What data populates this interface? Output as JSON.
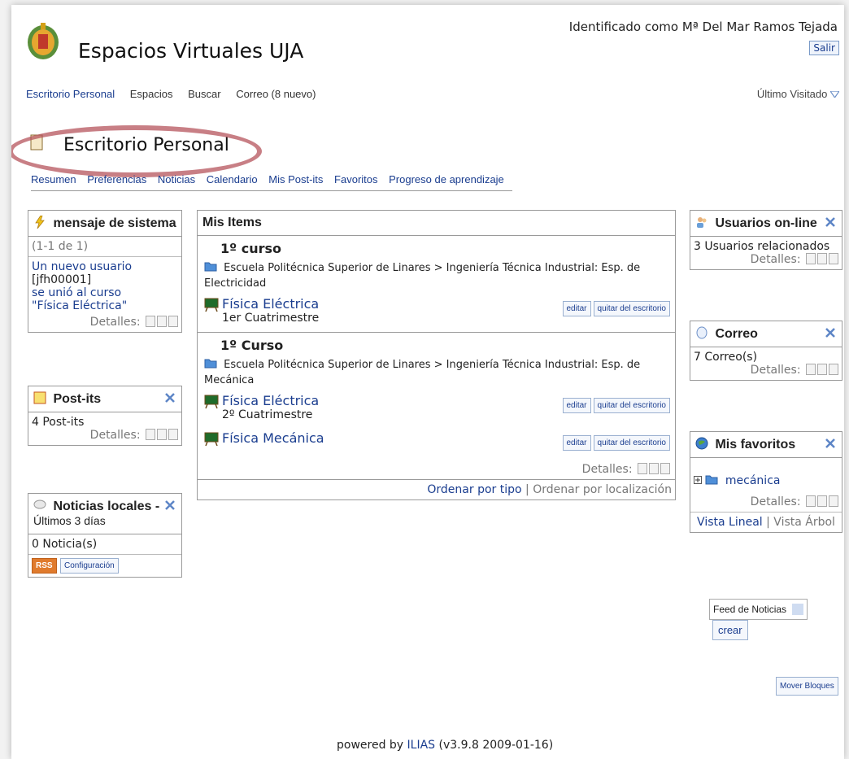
{
  "header": {
    "site_title": "Espacios Virtuales UJA",
    "user_label": "Identificado como Mª Del Mar Ramos Tejada",
    "logout": "Salir"
  },
  "topnav": {
    "items": [
      "Escritorio Personal",
      "Espacios",
      "Buscar",
      "Correo (8 nuevo)"
    ],
    "last_visited": "Último Visitado"
  },
  "page": {
    "title": "Escritorio Personal",
    "tabs": [
      "Resumen",
      "Preferencias",
      "Noticias",
      "Calendario",
      "Mis Post-its",
      "Favoritos",
      "Progreso de aprendizaje"
    ]
  },
  "common": {
    "details": "Detalles:"
  },
  "system_message": {
    "title": "mensaje de sistema",
    "range": "(1-1 de 1)",
    "message_link": "Un nuevo usuario",
    "message_user": "[jfh00001]",
    "message_link2": "se unió al curso",
    "message_link3": "\"Física Eléctrica\""
  },
  "postits": {
    "title": "Post-its",
    "count": "4 Post-its"
  },
  "news": {
    "title": "Noticias locales -",
    "subtitle": "Últimos 3 días",
    "count": "0 Noticia(s)",
    "rss": "RSS",
    "config": "Configuración"
  },
  "items": {
    "title": "Mis Items",
    "edit": "editar",
    "remove": "quitar del escritorio",
    "groups": [
      {
        "title": "1º curso",
        "path": "Escuela Politécnica Superior de Linares > Ingeniería Técnica Industrial: Esp. de Electricidad",
        "courses": [
          {
            "name": "Física Eléctrica",
            "term": "1er Cuatrimestre"
          }
        ]
      },
      {
        "title": "1º Curso",
        "path": "Escuela Politécnica Superior de Linares > Ingeniería Técnica Industrial: Esp. de Mecánica",
        "courses": [
          {
            "name": "Física Eléctrica",
            "term": "2º Cuatrimestre"
          },
          {
            "name": "Física Mecánica",
            "term": ""
          }
        ]
      }
    ],
    "sort_type": "Ordenar por tipo",
    "sort_sep": "|",
    "sort_location": "Ordenar por localización"
  },
  "online": {
    "title": "Usuarios on-line",
    "count": "3 Usuarios relacionados"
  },
  "mail": {
    "title": "Correo",
    "count": "7 Correo(s)"
  },
  "favorites": {
    "title": "Mis favoritos",
    "item": "mecánica",
    "view_linear": "Vista Lineal",
    "view_sep": "|",
    "view_tree": "Vista Árbol"
  },
  "feed": {
    "select_value": "Feed de Noticias",
    "create": "crear"
  },
  "move_blocks": "Mover Bloques",
  "footer": {
    "prefix": "powered by",
    "link": "ILIAS",
    "suffix": "(v3.9.8 2009-01-16)"
  },
  "colors": {
    "link": "#1a3d8f",
    "highlight": "#b5545c",
    "rss": "#e07b2d"
  }
}
